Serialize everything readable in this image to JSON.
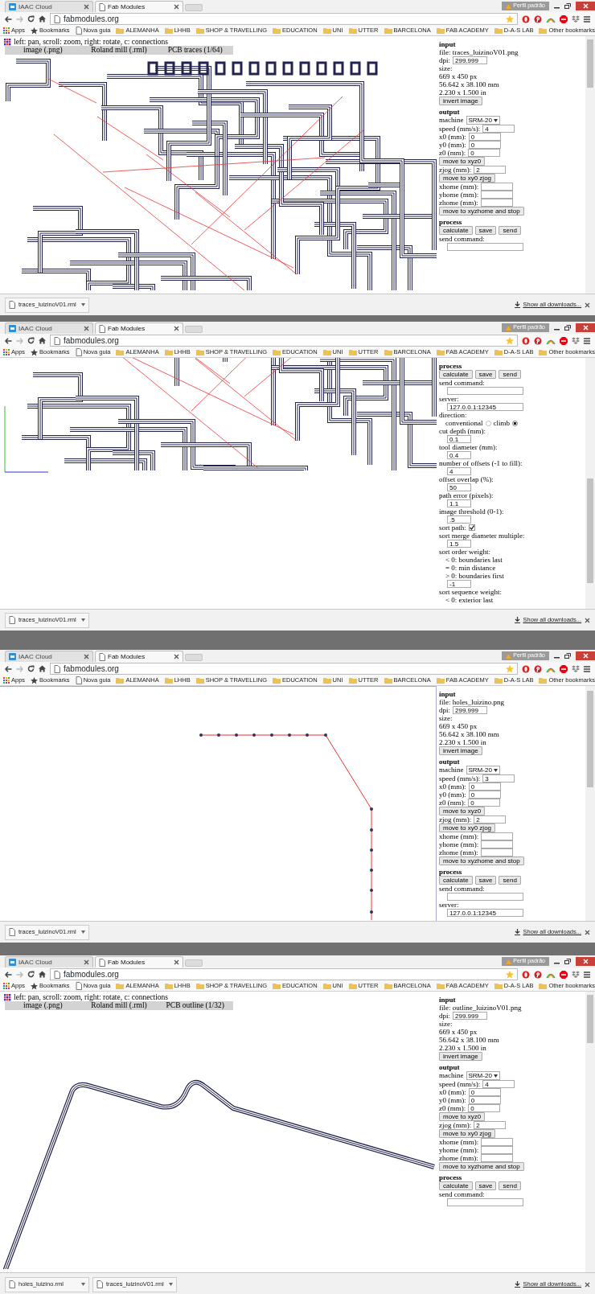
{
  "windows": [
    {
      "tabs": [
        {
          "title": "IAAC Cloud",
          "kind": "iaac",
          "selected": false
        },
        {
          "title": "Fab Modules",
          "kind": "page",
          "selected": true
        }
      ],
      "profile": "Perfil padrão",
      "url": "fabmodules.org",
      "bookmarks": [
        {
          "label": "Apps",
          "kind": "apps"
        },
        {
          "label": "Bookmarks",
          "kind": "star"
        },
        {
          "label": "Nova guia",
          "kind": "page"
        },
        {
          "label": "ALEMANHA",
          "kind": "folder"
        },
        {
          "label": "LHHB",
          "kind": "folder"
        },
        {
          "label": "SHOP & TRAVELLING",
          "kind": "folder"
        },
        {
          "label": "EDUCATION",
          "kind": "folder"
        },
        {
          "label": "UNI",
          "kind": "folder"
        },
        {
          "label": "UTTER",
          "kind": "folder"
        },
        {
          "label": "BARCELONA",
          "kind": "folder"
        },
        {
          "label": "FAB ACADEMY",
          "kind": "folder"
        },
        {
          "label": "D-A-S LAB",
          "kind": "folder"
        }
      ],
      "other_bookmarks": "Other bookmarks",
      "app": {
        "hint": "left: pan, scroll: zoom, right: rotate, c: connections",
        "modules": [
          "image (.png)",
          "Roland mill (.rml)",
          "PCB traces (1/64)"
        ],
        "canvas": {
          "kind": "traces"
        },
        "panel": [
          {
            "kind": "heading",
            "text": "input"
          },
          {
            "kind": "text",
            "text": "file: traces_luizinoV01.png"
          },
          {
            "kind": "field",
            "label": "dpi:",
            "value": "299.999"
          },
          {
            "kind": "text",
            "text": "size:"
          },
          {
            "kind": "text",
            "text": "669 x 450 px"
          },
          {
            "kind": "text",
            "text": "56.642 x 38.100 mm"
          },
          {
            "kind": "text",
            "text": "2.230 x 1.500 in"
          },
          {
            "kind": "button",
            "text": "invert image"
          },
          {
            "kind": "heading",
            "text": "output"
          },
          {
            "kind": "select",
            "label": "machine",
            "value": "SRM-20"
          },
          {
            "kind": "field",
            "label": "speed (mm/s):",
            "value": "4"
          },
          {
            "kind": "field",
            "label": "x0 (mm):",
            "value": "0"
          },
          {
            "kind": "field",
            "label": "y0 (mm):",
            "value": "0"
          },
          {
            "kind": "field",
            "label": "z0 (mm):",
            "value": "0"
          },
          {
            "kind": "button",
            "text": "move to xyz0"
          },
          {
            "kind": "field",
            "label": "zjog (mm):",
            "value": "2"
          },
          {
            "kind": "button",
            "text": "move to xy0 zjog"
          },
          {
            "kind": "field",
            "label": "xhome (mm):"
          },
          {
            "kind": "field",
            "label": "yhome (mm):"
          },
          {
            "kind": "field",
            "label": "zhome (mm):"
          },
          {
            "kind": "button",
            "text": "move to xyzhome and stop"
          },
          {
            "kind": "heading",
            "text": "process"
          },
          {
            "kind": "buttons",
            "labels": [
              "calculate",
              "save",
              "send"
            ]
          },
          {
            "kind": "text",
            "text": "send command:"
          },
          {
            "kind": "input"
          }
        ]
      },
      "downloads": [
        "traces_luizinoV01.rml"
      ],
      "show_all": "Show all downloads..."
    },
    {
      "tabs": [
        {
          "title": "IAAC Cloud",
          "kind": "iaac",
          "selected": false
        },
        {
          "title": "Fab Modules",
          "kind": "page",
          "selected": true
        }
      ],
      "profile": "Perfil padrão",
      "url": "fabmodules.org",
      "bookmarks": [
        {
          "label": "Apps",
          "kind": "apps"
        },
        {
          "label": "Bookmarks",
          "kind": "star"
        },
        {
          "label": "Nova guia",
          "kind": "page"
        },
        {
          "label": "ALEMANHA",
          "kind": "folder"
        },
        {
          "label": "LHHB",
          "kind": "folder"
        },
        {
          "label": "SHOP & TRAVELLING",
          "kind": "folder"
        },
        {
          "label": "EDUCATION",
          "kind": "folder"
        },
        {
          "label": "UNI",
          "kind": "folder"
        },
        {
          "label": "UTTER",
          "kind": "folder"
        },
        {
          "label": "BARCELONA",
          "kind": "folder"
        },
        {
          "label": "FAB ACADEMY",
          "kind": "folder"
        },
        {
          "label": "D-A-S LAB",
          "kind": "folder"
        }
      ],
      "other_bookmarks": "Other bookmarks",
      "app": {
        "canvas": {
          "kind": "traces_scrolled"
        },
        "panel": [
          {
            "kind": "heading",
            "text": "process"
          },
          {
            "kind": "buttons",
            "labels": [
              "calculate",
              "save",
              "send"
            ]
          },
          {
            "kind": "text",
            "text": "send command:"
          },
          {
            "kind": "input"
          },
          {
            "kind": "text",
            "text": "server:"
          },
          {
            "kind": "input",
            "value": "127.0.0.1:12345"
          },
          {
            "kind": "text",
            "text": "direction:"
          },
          {
            "kind": "radio",
            "options": [
              {
                "label": "conventional",
                "selected": false
              },
              {
                "label": "climb",
                "selected": true
              }
            ]
          },
          {
            "kind": "text",
            "text": "cut depth (mm):"
          },
          {
            "kind": "input",
            "value": "0.1"
          },
          {
            "kind": "text",
            "text": "tool diameter (mm):"
          },
          {
            "kind": "input",
            "value": "0.4"
          },
          {
            "kind": "text",
            "text": "number of offsets (-1 to fill):"
          },
          {
            "kind": "input",
            "value": "4"
          },
          {
            "kind": "text",
            "text": "offset overlap (%):"
          },
          {
            "kind": "input",
            "value": "50"
          },
          {
            "kind": "text",
            "text": "path error (pixels):"
          },
          {
            "kind": "input",
            "value": "1.1"
          },
          {
            "kind": "text",
            "text": "image threshold (0-1):"
          },
          {
            "kind": "input",
            "value": ".5"
          },
          {
            "kind": "check",
            "label": "sort path:",
            "checked": true
          },
          {
            "kind": "text",
            "text": "sort merge diameter multiple:"
          },
          {
            "kind": "input",
            "value": "1.5"
          },
          {
            "kind": "text",
            "text": "sort order weight:"
          },
          {
            "kind": "note",
            "text": "< 0: boundaries last"
          },
          {
            "kind": "note",
            "text": "= 0: min distance"
          },
          {
            "kind": "note",
            "text": "> 0: boundaries first"
          },
          {
            "kind": "input",
            "value": "-1"
          },
          {
            "kind": "text",
            "text": "sort sequence weight:"
          },
          {
            "kind": "note",
            "text": "< 0: exterior last"
          }
        ]
      },
      "downloads": [
        "traces_luizinoV01.rml"
      ],
      "show_all": "Show all downloads..."
    },
    {
      "tabs": [
        {
          "title": "IAAC Cloud",
          "kind": "iaac",
          "selected": false
        },
        {
          "title": "Fab Modules",
          "kind": "page",
          "selected": true
        }
      ],
      "profile": "Perfil padrão",
      "url": "fabmodules.org",
      "bookmarks": [
        {
          "label": "Apps",
          "kind": "apps"
        },
        {
          "label": "Bookmarks",
          "kind": "star"
        },
        {
          "label": "Nova guia",
          "kind": "page"
        },
        {
          "label": "ALEMANHA",
          "kind": "folder"
        },
        {
          "label": "LHHB",
          "kind": "folder"
        },
        {
          "label": "SHOP & TRAVELLING",
          "kind": "folder"
        },
        {
          "label": "EDUCATION",
          "kind": "folder"
        },
        {
          "label": "UNI",
          "kind": "folder"
        },
        {
          "label": "UTTER",
          "kind": "folder"
        },
        {
          "label": "BARCELONA",
          "kind": "folder"
        },
        {
          "label": "FAB ACADEMY",
          "kind": "folder"
        },
        {
          "label": "D-A-S LAB",
          "kind": "folder"
        }
      ],
      "other_bookmarks": "Other bookmarks",
      "app": {
        "canvas": {
          "kind": "holes"
        },
        "panel": [
          {
            "kind": "heading",
            "text": "input"
          },
          {
            "kind": "text",
            "text": "file: holes_luizino.png"
          },
          {
            "kind": "field",
            "label": "dpi:",
            "value": "299.999"
          },
          {
            "kind": "text",
            "text": "size:"
          },
          {
            "kind": "text",
            "text": "669 x 450 px"
          },
          {
            "kind": "text",
            "text": "56.642 x 38.100 mm"
          },
          {
            "kind": "text",
            "text": "2.230 x 1.500 in"
          },
          {
            "kind": "button",
            "text": "invert image"
          },
          {
            "kind": "heading",
            "text": "output"
          },
          {
            "kind": "select",
            "label": "machine",
            "value": "SRM-20"
          },
          {
            "kind": "field",
            "label": "speed (mm/s):",
            "value": "3"
          },
          {
            "kind": "field",
            "label": "x0 (mm):",
            "value": "0"
          },
          {
            "kind": "field",
            "label": "y0 (mm):",
            "value": "0"
          },
          {
            "kind": "field",
            "label": "z0 (mm):",
            "value": "0"
          },
          {
            "kind": "button",
            "text": "move to xyz0"
          },
          {
            "kind": "field",
            "label": "zjog (mm):",
            "value": "2"
          },
          {
            "kind": "button",
            "text": "move to xy0 zjog"
          },
          {
            "kind": "field",
            "label": "xhome (mm):"
          },
          {
            "kind": "field",
            "label": "yhome (mm):"
          },
          {
            "kind": "field",
            "label": "zhome (mm):"
          },
          {
            "kind": "button",
            "text": "move to xyzhome and stop"
          },
          {
            "kind": "heading",
            "text": "process"
          },
          {
            "kind": "buttons",
            "labels": [
              "calculate",
              "save",
              "send"
            ]
          },
          {
            "kind": "text",
            "text": "send command:"
          },
          {
            "kind": "input"
          },
          {
            "kind": "text",
            "text": "server:"
          },
          {
            "kind": "input",
            "value": "127.0.0.1:12345"
          }
        ]
      },
      "downloads": [
        "traces_luizinoV01.rml"
      ],
      "show_all": "Show all downloads..."
    },
    {
      "tabs": [
        {
          "title": "IAAC Cloud",
          "kind": "iaac",
          "selected": false
        },
        {
          "title": "Fab Modules",
          "kind": "page",
          "selected": true
        }
      ],
      "profile": "Perfil padrão",
      "url": "fabmodules.org",
      "bookmarks": [
        {
          "label": "Apps",
          "kind": "apps"
        },
        {
          "label": "Bookmarks",
          "kind": "star"
        },
        {
          "label": "Nova guia",
          "kind": "page"
        },
        {
          "label": "ALEMANHA",
          "kind": "folder"
        },
        {
          "label": "LHHB",
          "kind": "folder"
        },
        {
          "label": "SHOP & TRAVELLING",
          "kind": "folder"
        },
        {
          "label": "EDUCATION",
          "kind": "folder"
        },
        {
          "label": "UNI",
          "kind": "folder"
        },
        {
          "label": "UTTER",
          "kind": "folder"
        },
        {
          "label": "BARCELONA",
          "kind": "folder"
        },
        {
          "label": "FAB ACADEMY",
          "kind": "folder"
        },
        {
          "label": "D-A-S LAB",
          "kind": "folder"
        }
      ],
      "other_bookmarks": "Other bookmarks",
      "app": {
        "hint": "left: pan, scroll: zoom, right: rotate, c: connections",
        "modules": [
          "image (.png)",
          "Roland mill (.rml)",
          "PCB outline (1/32)"
        ],
        "canvas": {
          "kind": "outline"
        },
        "panel": [
          {
            "kind": "heading",
            "text": "input"
          },
          {
            "kind": "text",
            "text": "file: outline_luizinoV01.png"
          },
          {
            "kind": "field",
            "label": "dpi:",
            "value": "299.999"
          },
          {
            "kind": "text",
            "text": "size:"
          },
          {
            "kind": "text",
            "text": "669 x 450 px"
          },
          {
            "kind": "text",
            "text": "56.642 x 38.100 mm"
          },
          {
            "kind": "text",
            "text": "2.230 x 1.500 in"
          },
          {
            "kind": "button",
            "text": "invert image"
          },
          {
            "kind": "heading",
            "text": "output"
          },
          {
            "kind": "select",
            "label": "machine",
            "value": "SRM-20"
          },
          {
            "kind": "field",
            "label": "speed (mm/s):",
            "value": "4"
          },
          {
            "kind": "field",
            "label": "x0 (mm):",
            "value": "0"
          },
          {
            "kind": "field",
            "label": "y0 (mm):",
            "value": "0"
          },
          {
            "kind": "field",
            "label": "z0 (mm):",
            "value": "0"
          },
          {
            "kind": "button",
            "text": "move to xyz0"
          },
          {
            "kind": "field",
            "label": "zjog (mm):",
            "value": "2"
          },
          {
            "kind": "button",
            "text": "move to xy0 zjog"
          },
          {
            "kind": "field",
            "label": "xhome (mm):"
          },
          {
            "kind": "field",
            "label": "yhome (mm):"
          },
          {
            "kind": "field",
            "label": "zhome (mm):"
          },
          {
            "kind": "button",
            "text": "move to xyzhome and stop"
          },
          {
            "kind": "heading",
            "text": "process"
          },
          {
            "kind": "buttons",
            "labels": [
              "calculate",
              "save",
              "send"
            ]
          },
          {
            "kind": "text",
            "text": "send command:"
          },
          {
            "kind": "input"
          }
        ]
      },
      "downloads": [
        "holes_luizino.rml",
        "traces_luizinoV01.rml"
      ],
      "show_all": "Show all downloads..."
    }
  ]
}
